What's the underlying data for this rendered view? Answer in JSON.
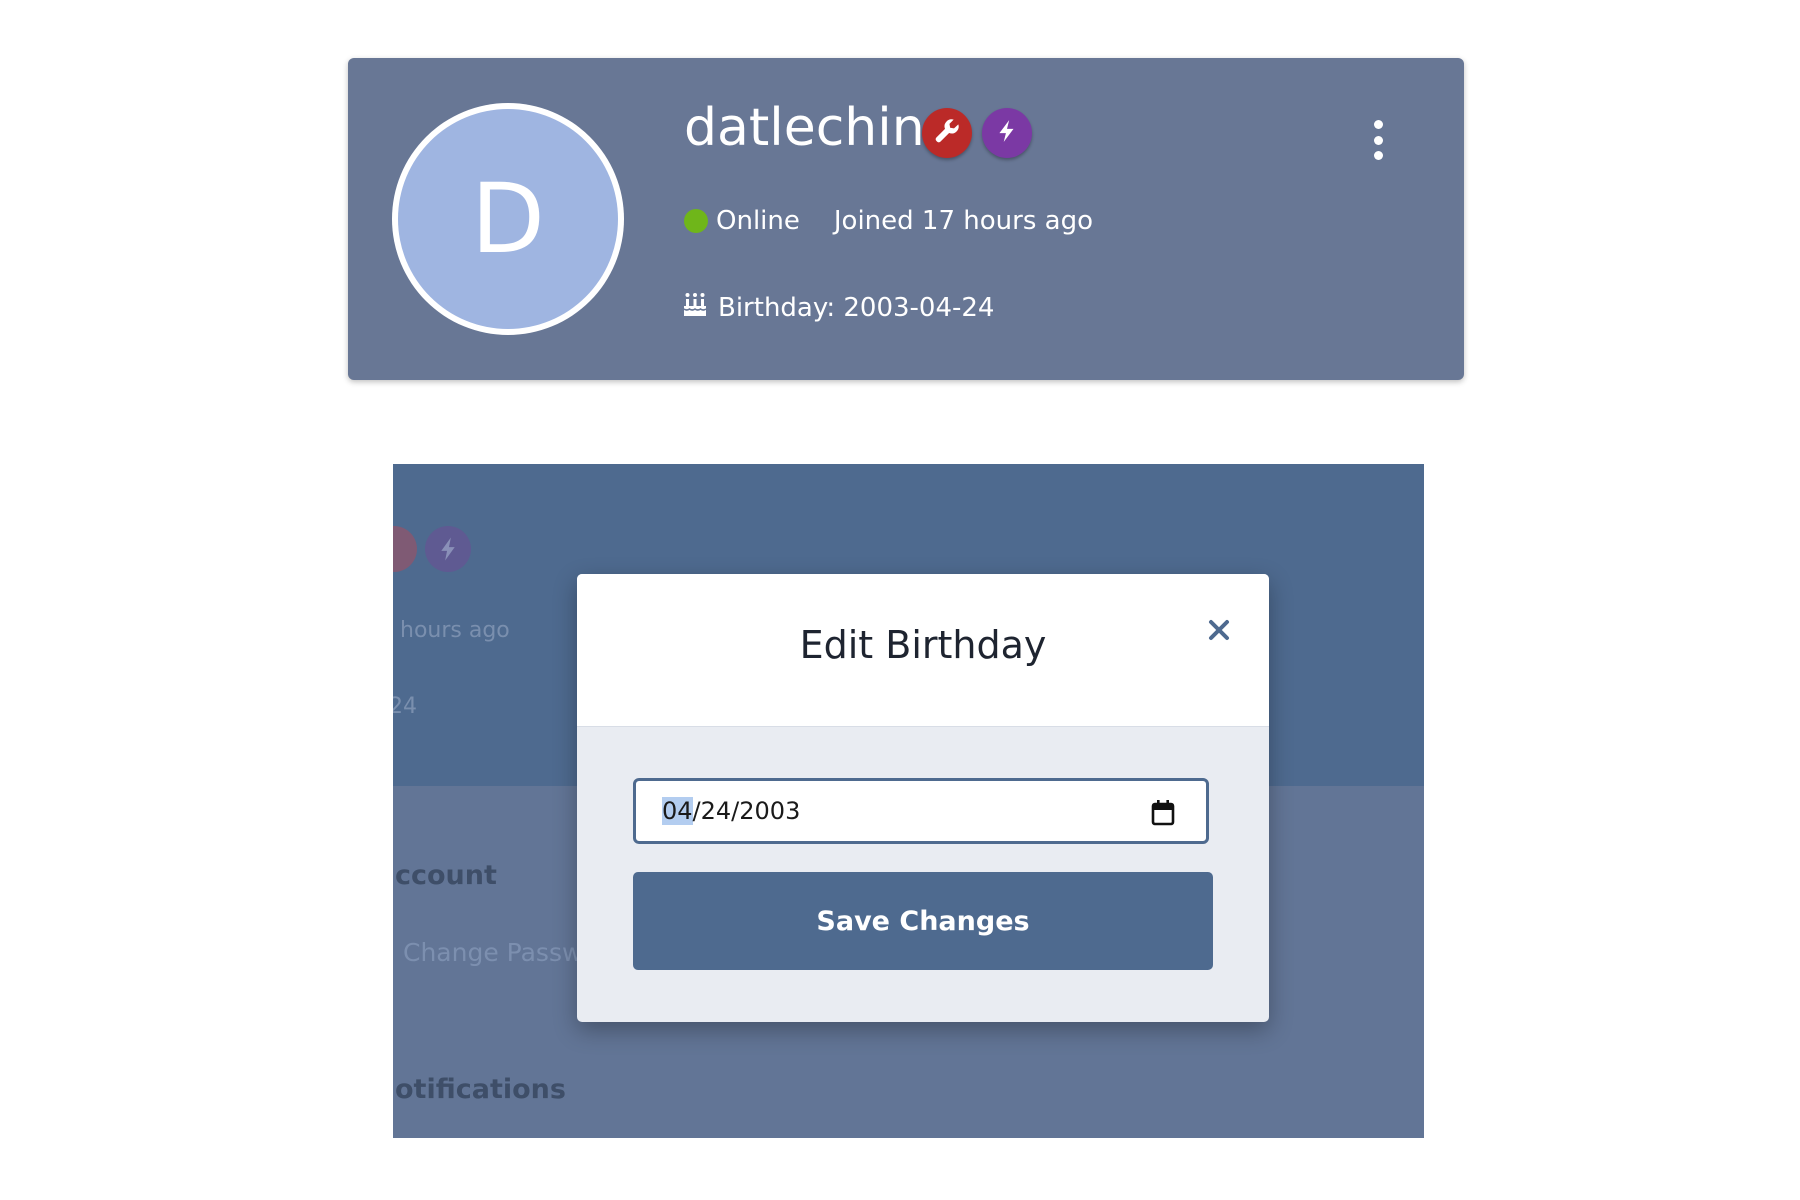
{
  "profile": {
    "avatar_initial": "D",
    "username": "datlechin",
    "badges": [
      {
        "icon": "wrench-icon",
        "color": "#bb2a28"
      },
      {
        "icon": "bolt-icon",
        "color": "#7b39a4"
      }
    ],
    "status": "Online",
    "status_color": "#6fb61a",
    "joined": "Joined 17 hours ago",
    "birthday": "Birthday: 2003-04-24",
    "card_color": "#687795",
    "avatar_color": "#9fb5e1"
  },
  "background_panel": {
    "joined_fragment": "hours ago",
    "birthday_fragment": "24",
    "section_account": "ccount",
    "link_change_password": "Change Passwo",
    "section_notifications": "otifications"
  },
  "modal": {
    "title": "Edit Birthday",
    "date_month": "04",
    "date_rest": "/24/2003",
    "save_label": "Save Changes",
    "accent_color": "#4e6a8f"
  }
}
